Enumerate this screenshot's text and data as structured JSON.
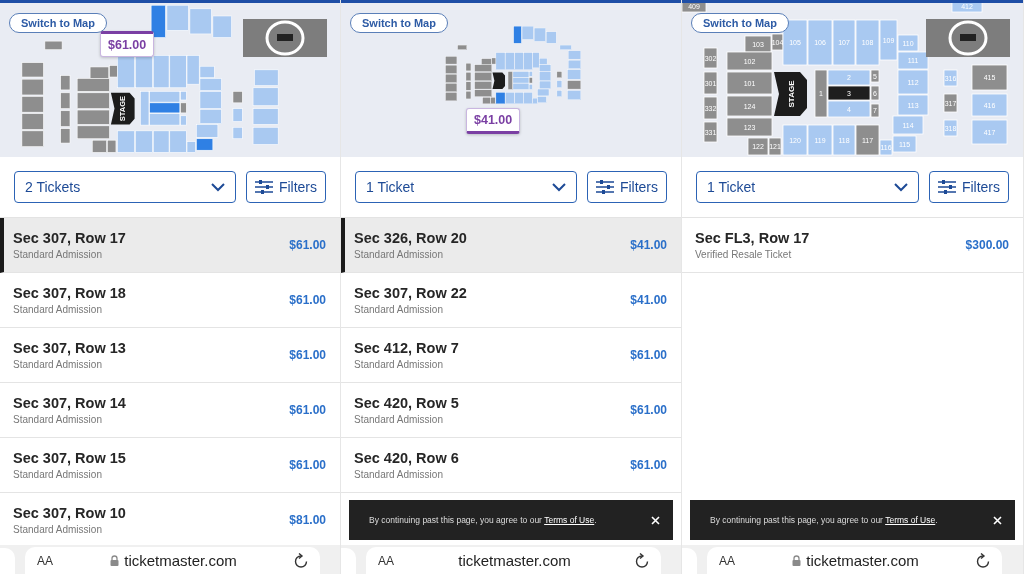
{
  "panels": [
    {
      "map": {
        "switch_button": "Switch to Map",
        "stage_label": "STAGE",
        "inset": true,
        "price_tag": {
          "text": "$61.00",
          "points_down": false
        },
        "sections": [
          {
            "kind": "unavailable"
          },
          {
            "kind": "unavailable"
          },
          {
            "kind": "unavailable"
          },
          {
            "kind": "unavailable"
          },
          {
            "kind": "unavailable"
          },
          {
            "kind": "unavailable"
          },
          {
            "kind": "unavailable"
          },
          {
            "kind": "unavailable"
          },
          {
            "kind": "unavailable"
          },
          {
            "kind": "unavailable"
          },
          {
            "kind": "unavailable"
          },
          {
            "kind": "unavailable"
          },
          {
            "kind": "available"
          },
          {
            "kind": "available"
          },
          {
            "kind": "available"
          },
          {
            "kind": "available"
          },
          {
            "kind": "available"
          },
          {
            "kind": "available"
          },
          {
            "kind": "available"
          },
          {
            "kind": "available"
          },
          {
            "kind": "available"
          },
          {
            "kind": "available"
          },
          {
            "kind": "selected"
          },
          {
            "kind": "available"
          },
          {
            "kind": "available"
          },
          {
            "kind": "available"
          },
          {
            "kind": "available"
          },
          {
            "kind": "available"
          },
          {
            "kind": "available"
          },
          {
            "kind": "available"
          },
          {
            "kind": "selected"
          },
          {
            "kind": "available"
          },
          {
            "kind": "available"
          },
          {
            "kind": "unavailable"
          },
          {
            "kind": "available"
          },
          {
            "kind": "unavailable"
          },
          {
            "kind": "available"
          },
          {
            "kind": "available"
          },
          {
            "kind": "available"
          },
          {
            "kind": "available"
          },
          {
            "kind": "available"
          },
          {
            "kind": "unavailable"
          },
          {
            "kind": "unavailable"
          },
          {
            "kind": "unavailable"
          },
          {
            "kind": "unavailable"
          },
          {
            "kind": "unavailable"
          },
          {
            "kind": "unavailable"
          },
          {
            "kind": "available"
          },
          {
            "kind": "selected"
          },
          {
            "kind": "available"
          },
          {
            "kind": "available"
          },
          {
            "kind": "available"
          }
        ]
      },
      "ticket_select": {
        "value": "2 Tickets"
      },
      "filters_button": "Filters",
      "listings": [
        {
          "title": "Sec 307, Row 17",
          "subtitle": "Standard Admission",
          "price": "$61.00",
          "selected": true
        },
        {
          "title": "Sec 307, Row 18",
          "subtitle": "Standard Admission",
          "price": "$61.00",
          "selected": false
        },
        {
          "title": "Sec 307, Row 13",
          "subtitle": "Standard Admission",
          "price": "$61.00",
          "selected": false
        },
        {
          "title": "Sec 307, Row 14",
          "subtitle": "Standard Admission",
          "price": "$61.00",
          "selected": false
        },
        {
          "title": "Sec 307, Row 15",
          "subtitle": "Standard Admission",
          "price": "$61.00",
          "selected": false
        },
        {
          "title": "Sec 307, Row 10",
          "subtitle": "Standard Admission",
          "price": "$81.00",
          "selected": false
        }
      ],
      "browser_bar": {
        "text_size": "AA",
        "url": "ticketmaster.com",
        "secure": true
      }
    },
    {
      "map": {
        "switch_button": "Switch to Map",
        "inset": false,
        "price_tag": {
          "text": "$41.00",
          "points_down": true
        },
        "sections": [
          {
            "kind": "unavailable"
          },
          {
            "kind": "unavailable"
          },
          {
            "kind": "unavailable"
          },
          {
            "kind": "unavailable"
          },
          {
            "kind": "unavailable"
          },
          {
            "kind": "unavailable"
          },
          {
            "kind": "unavailable"
          },
          {
            "kind": "unavailable"
          },
          {
            "kind": "unavailable"
          },
          {
            "kind": "unavailable"
          },
          {
            "kind": "unavailable"
          },
          {
            "kind": "unavailable"
          },
          {
            "kind": "available"
          },
          {
            "kind": "available"
          },
          {
            "kind": "available"
          },
          {
            "kind": "available"
          },
          {
            "kind": "available"
          },
          {
            "kind": "available"
          },
          {
            "kind": "available"
          },
          {
            "kind": "available"
          },
          {
            "kind": "available"
          },
          {
            "kind": "available"
          },
          {
            "kind": "available"
          },
          {
            "kind": "available"
          },
          {
            "kind": "selected"
          },
          {
            "kind": "available"
          },
          {
            "kind": "available"
          },
          {
            "kind": "available"
          },
          {
            "kind": "unavailable"
          },
          {
            "kind": "available"
          },
          {
            "kind": "available"
          },
          {
            "kind": "available"
          },
          {
            "kind": "available"
          },
          {
            "kind": "unavailable"
          },
          {
            "kind": "available"
          },
          {
            "kind": "unavailable"
          },
          {
            "kind": "available"
          },
          {
            "kind": "available"
          },
          {
            "kind": "available"
          },
          {
            "kind": "unavailable"
          },
          {
            "kind": "available"
          },
          {
            "kind": "unavailable"
          },
          {
            "kind": "available"
          },
          {
            "kind": "unavailable"
          },
          {
            "kind": "unavailable"
          },
          {
            "kind": "unavailable"
          },
          {
            "kind": "unavailable"
          },
          {
            "kind": "unavailable"
          },
          {
            "kind": "available"
          },
          {
            "kind": "available"
          },
          {
            "kind": "selected"
          },
          {
            "kind": "available"
          },
          {
            "kind": "available"
          },
          {
            "kind": "available"
          }
        ]
      },
      "ticket_select": {
        "value": "1 Ticket"
      },
      "filters_button": "Filters",
      "listings": [
        {
          "title": "Sec 326, Row 20",
          "subtitle": "Standard Admission",
          "price": "$41.00",
          "selected": true
        },
        {
          "title": "Sec 307, Row 22",
          "subtitle": "Standard Admission",
          "price": "$41.00",
          "selected": false
        },
        {
          "title": "Sec 412, Row 7",
          "subtitle": "Standard Admission",
          "price": "$61.00",
          "selected": false
        },
        {
          "title": "Sec 420, Row 5",
          "subtitle": "Standard Admission",
          "price": "$61.00",
          "selected": false
        },
        {
          "title": "Sec 420, Row 6",
          "subtitle": "Standard Admission",
          "price": "$61.00",
          "selected": false
        }
      ],
      "cookie_banner": {
        "text": "By continuing past this page, you agree to our ",
        "link": "Terms of Use",
        "text_end": "."
      },
      "browser_bar": {
        "text_size": "AA",
        "url": "ticketmaster.com",
        "secure": false
      }
    },
    {
      "map": {
        "switch_button": "Switch to Map",
        "stage_label": "STAGE",
        "inset": true,
        "sections": [
          {
            "label": "103",
            "kind": "unavailable"
          },
          {
            "label": "104",
            "kind": "unavailable"
          },
          {
            "label": "102",
            "kind": "unavailable"
          },
          {
            "label": "101",
            "kind": "unavailable"
          },
          {
            "label": "124",
            "kind": "unavailable"
          },
          {
            "label": "123",
            "kind": "unavailable"
          },
          {
            "label": "122",
            "kind": "unavailable"
          },
          {
            "label": "121",
            "kind": "unavailable"
          },
          {
            "label": "302",
            "kind": "unavailable"
          },
          {
            "label": "301",
            "kind": "unavailable"
          },
          {
            "label": "332",
            "kind": "unavailable"
          },
          {
            "label": "331",
            "kind": "unavailable"
          },
          {
            "label": "105",
            "kind": "available"
          },
          {
            "label": "106",
            "kind": "available"
          },
          {
            "label": "107",
            "kind": "available"
          },
          {
            "label": "108",
            "kind": "available"
          },
          {
            "label": "109",
            "kind": "available"
          },
          {
            "label": "110",
            "kind": "available"
          },
          {
            "label": "111",
            "kind": "available"
          },
          {
            "label": "112",
            "kind": "available"
          },
          {
            "label": "113",
            "kind": "available"
          },
          {
            "label": "114",
            "kind": "available"
          },
          {
            "label": "115",
            "kind": "available"
          },
          {
            "label": "116",
            "kind": "available"
          },
          {
            "label": "120",
            "kind": "available"
          },
          {
            "label": "119",
            "kind": "available"
          },
          {
            "label": "118",
            "kind": "available"
          },
          {
            "label": "117",
            "kind": "unavailable"
          },
          {
            "label": "1",
            "kind": "unavailable"
          },
          {
            "label": "2",
            "kind": "available"
          },
          {
            "label": "3",
            "kind": "closed"
          },
          {
            "label": "4",
            "kind": "available"
          },
          {
            "label": "5",
            "kind": "unavailable"
          },
          {
            "label": "6",
            "kind": "unavailable"
          },
          {
            "label": "7",
            "kind": "unavailable"
          },
          {
            "label": "316",
            "kind": "available"
          },
          {
            "label": "317",
            "kind": "unavailable"
          },
          {
            "label": "318",
            "kind": "available"
          },
          {
            "label": "415",
            "kind": "unavailable"
          },
          {
            "label": "416",
            "kind": "available"
          },
          {
            "label": "417",
            "kind": "available"
          },
          {
            "label": "409",
            "kind": "unavailable"
          },
          {
            "label": "412",
            "kind": "available"
          }
        ]
      },
      "ticket_select": {
        "value": "1 Ticket"
      },
      "filters_button": "Filters",
      "listings": [
        {
          "title": "Sec FL3, Row 17",
          "subtitle": "Verified Resale Ticket",
          "price": "$300.00",
          "selected": false
        }
      ],
      "cookie_banner": {
        "text": "By continuing past this page, you agree to our ",
        "link": "Terms of Use",
        "text_end": "."
      },
      "browser_bar": {
        "text_size": "AA",
        "url": "ticketmaster.com",
        "secure": true
      }
    }
  ]
}
